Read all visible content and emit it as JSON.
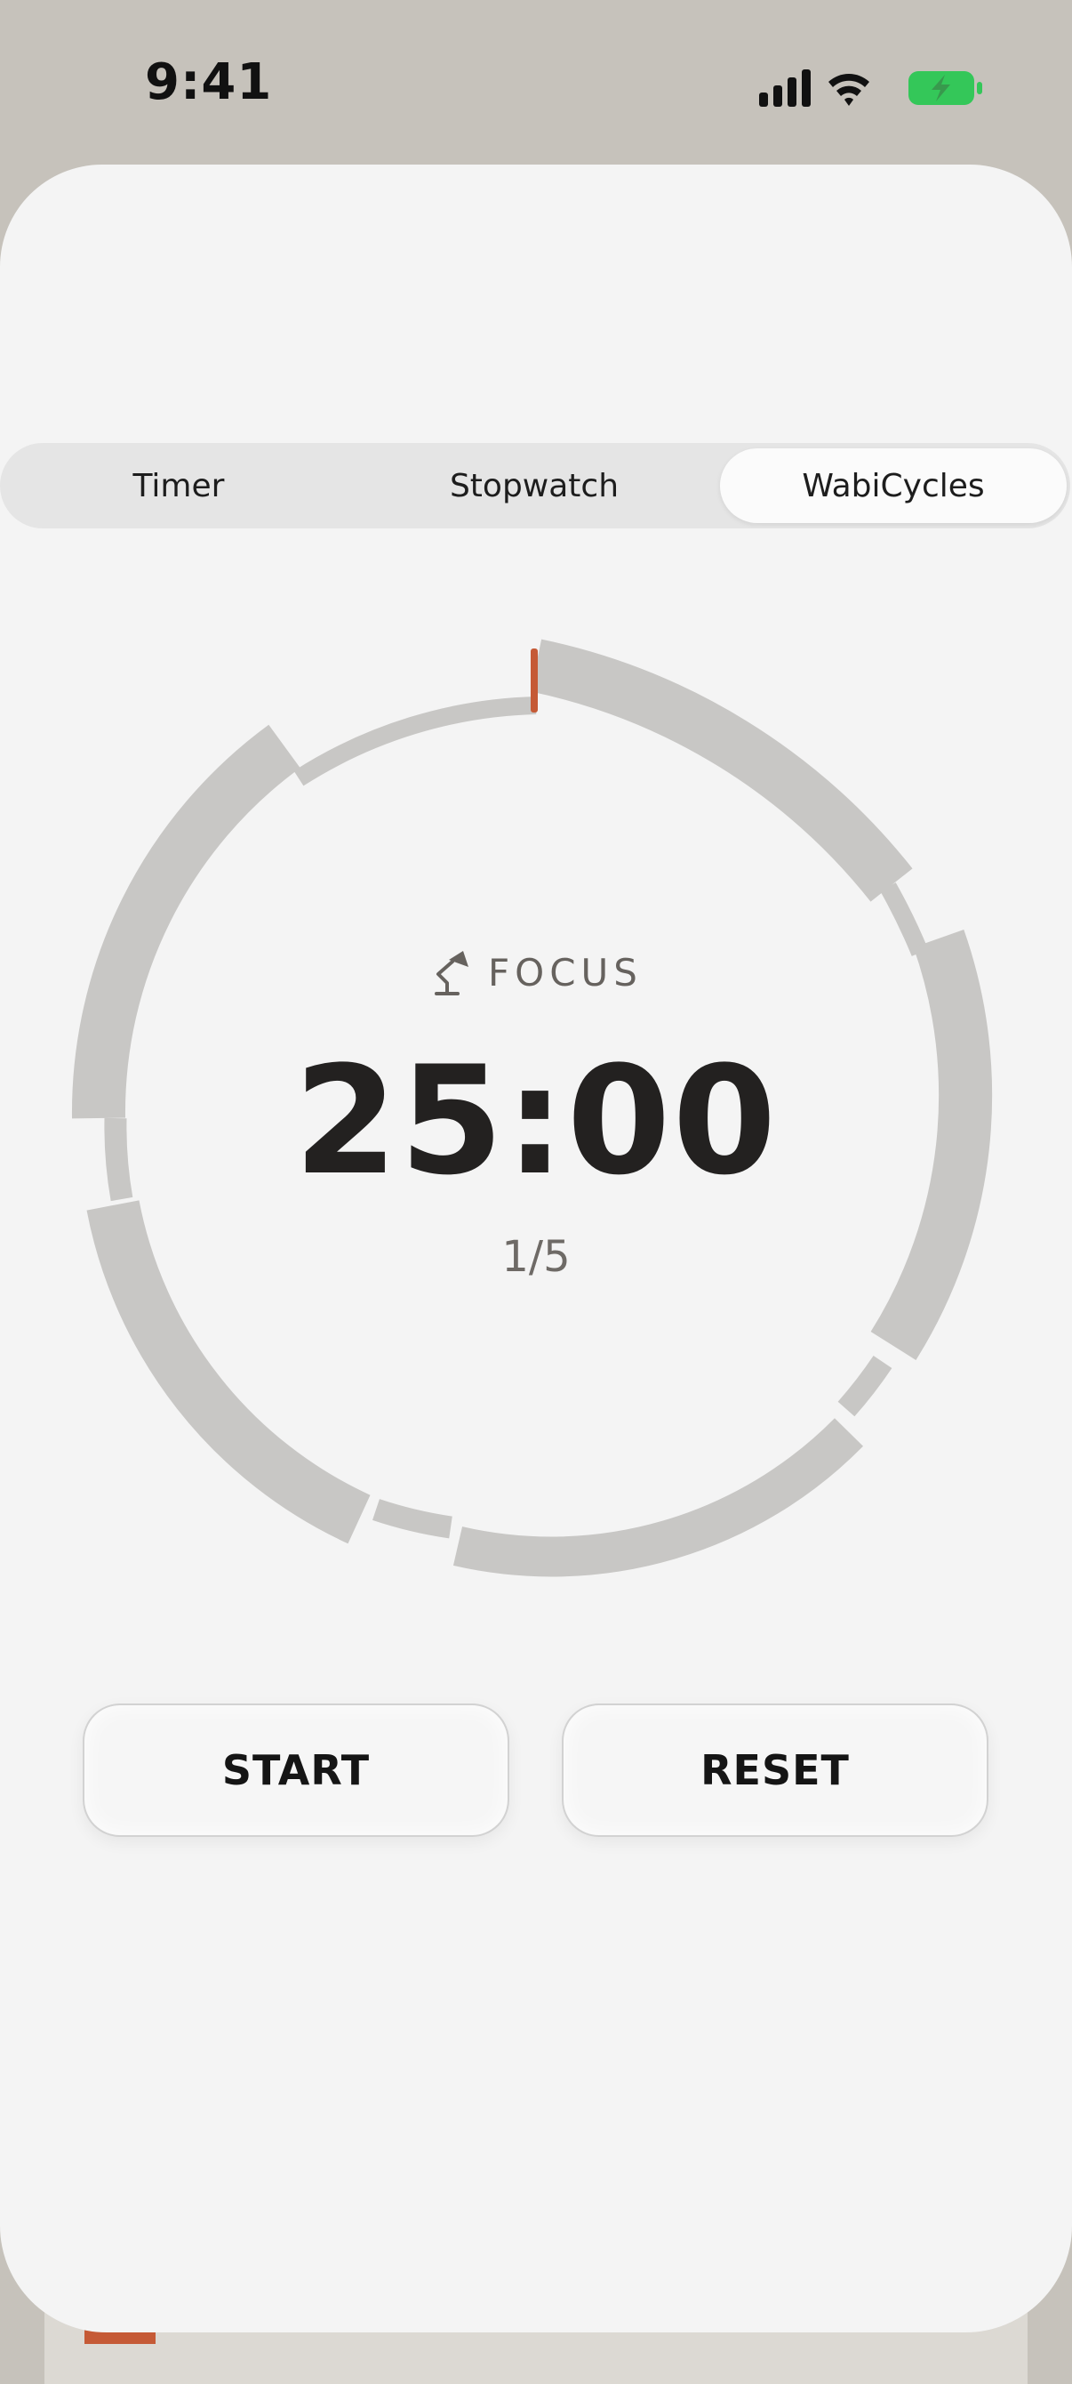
{
  "status_bar": {
    "time": "9:41",
    "icons": [
      "cellular-signal-icon",
      "wifi-icon",
      "battery-charging-icon"
    ],
    "battery_color": "#34c759"
  },
  "mode_tabs": {
    "items": [
      {
        "label": "Timer",
        "selected": false
      },
      {
        "label": "Stopwatch",
        "selected": false
      },
      {
        "label": "WabiCycles",
        "selected": true
      }
    ]
  },
  "timer": {
    "phase_icon": "desk-lamp-icon",
    "phase_label": "FOCUS",
    "time": "25:00",
    "cycle": "1/5"
  },
  "controls": {
    "start_label": "START",
    "reset_label": "RESET"
  },
  "colors": {
    "accent": "#c55a36",
    "ring_segment": "#c8c7c5",
    "card_background": "#f4f4f4",
    "backdrop": "#c6c2bb"
  }
}
